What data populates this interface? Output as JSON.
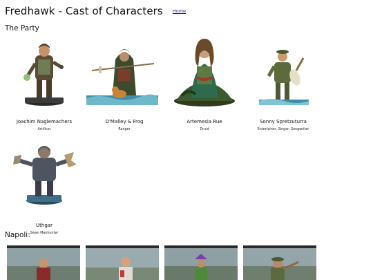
{
  "header": {
    "title": "Fredhawk - Cast of Characters",
    "home_link": "Home"
  },
  "sections": {
    "party": "The Party",
    "napoli": "Napoli:"
  },
  "party": [
    {
      "name": "Joachim Naglemachers",
      "role": "Artificer",
      "icon": "dwarf-artificer-miniature"
    },
    {
      "name": "O'Malley & Frog",
      "role": "Ranger",
      "icon": "hooded-ranger-miniature"
    },
    {
      "name": "Artemesia Rue",
      "role": "Druid",
      "icon": "seated-druid-miniature"
    },
    {
      "name": "Sonny Spretzuturra",
      "role": "Entertainer, Singer, Songwriter",
      "icon": "bard-with-lute-miniature"
    },
    {
      "name": "Uthgar",
      "role": "Swan Manhunter",
      "icon": "armored-hunter-miniature"
    }
  ],
  "colors": {
    "link": "#1a1aa6",
    "water": "#3f8fa8",
    "screenshot_frame": "#2e2e2e"
  }
}
